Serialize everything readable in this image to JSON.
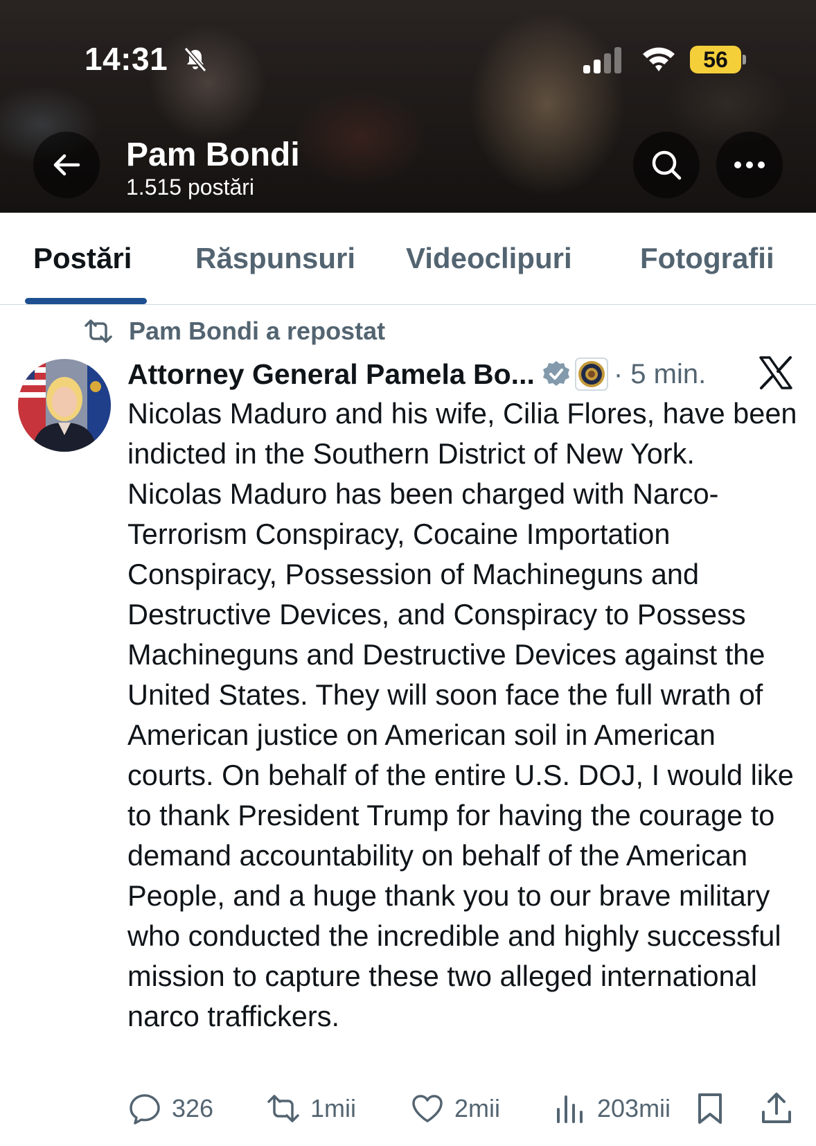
{
  "status_bar": {
    "time": "14:31",
    "battery": "56"
  },
  "profile": {
    "name": "Pam Bondi",
    "post_count": "1.515 postări"
  },
  "tabs": [
    {
      "label": "Postări",
      "active": true
    },
    {
      "label": "Răspunsuri",
      "active": false
    },
    {
      "label": "Videoclipuri",
      "active": false
    },
    {
      "label": "Fotografii",
      "active": false
    }
  ],
  "post": {
    "repost_label": "Pam Bondi a repostat",
    "author": "Attorney General Pamela Bo...",
    "time_ago": "· 5 min.",
    "text": "Nicolas Maduro and his wife, Cilia Flores, have been indicted in the Southern District of New York.  Nicolas Maduro has been charged with Narco-Terrorism Conspiracy, Cocaine Importation Conspiracy, Possession of Machineguns and Destructive Devices, and Conspiracy to Possess Machineguns and Destructive Devices against the United States. They will soon face the full wrath of American justice on American soil in American courts. On behalf of the entire U.S. DOJ, I would like to thank President Trump for having the courage to demand accountability on behalf of the American People, and a huge thank you to our brave military who conducted the incredible and highly successful mission to capture these two alleged international narco traffickers.",
    "stats": {
      "replies": "326",
      "reposts": "1mii",
      "likes": "2mii",
      "views": "203mii"
    }
  },
  "colors": {
    "accent": "#1d4f91",
    "secondary_text": "#536471",
    "verified": "#829aab",
    "battery": "#f5cf3a"
  }
}
